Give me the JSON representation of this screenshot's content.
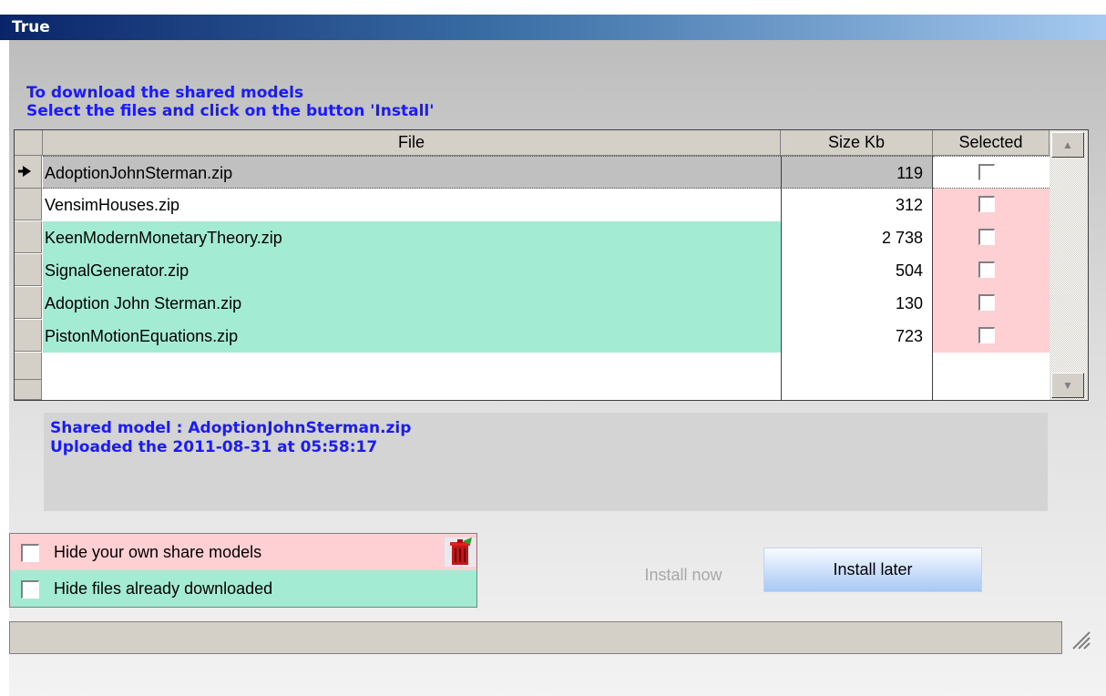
{
  "window": {
    "title": "True"
  },
  "instructions": {
    "line1": "To download the shared models",
    "line2": "Select the files and click on the button 'Install'"
  },
  "table": {
    "columns": [
      "File",
      "Size Kb",
      "Selected"
    ],
    "rows": [
      {
        "file": "AdoptionJohnSterman.zip",
        "size": "119",
        "selected": false
      },
      {
        "file": "VensimHouses.zip",
        "size": "312",
        "selected": false
      },
      {
        "file": "KeenModernMonetaryTheory.zip",
        "size": "2 738",
        "selected": false
      },
      {
        "file": "SignalGenerator.zip",
        "size": "504",
        "selected": false
      },
      {
        "file": "Adoption John Sterman.zip",
        "size": "130",
        "selected": false
      },
      {
        "file": "PistonMotionEquations.zip",
        "size": "723",
        "selected": false
      }
    ]
  },
  "info": {
    "line1": "Shared model : AdoptionJohnSterman.zip",
    "line2": "Uploaded the 2011-08-31 at 05:58:17"
  },
  "filters": {
    "hide_own": {
      "label": "Hide your own share models",
      "checked": false
    },
    "hide_downloaded": {
      "label": "Hide files already downloaded",
      "checked": false
    }
  },
  "buttons": {
    "install_now": "Install now",
    "install_later": "Install later"
  },
  "colors": {
    "title_gradient_start": "#0a246a",
    "accent_text": "#1a1aff",
    "row_green": "#a3ecd3",
    "row_pink": "#ffd0d3",
    "current_row_gray": "#c0c0c0"
  },
  "icons": {
    "current_row": "arrow-right-icon",
    "delete": "trash-icon",
    "scroll_up": "scroll-up-icon",
    "scroll_down": "scroll-down-icon",
    "resize": "resize-grip-icon"
  }
}
